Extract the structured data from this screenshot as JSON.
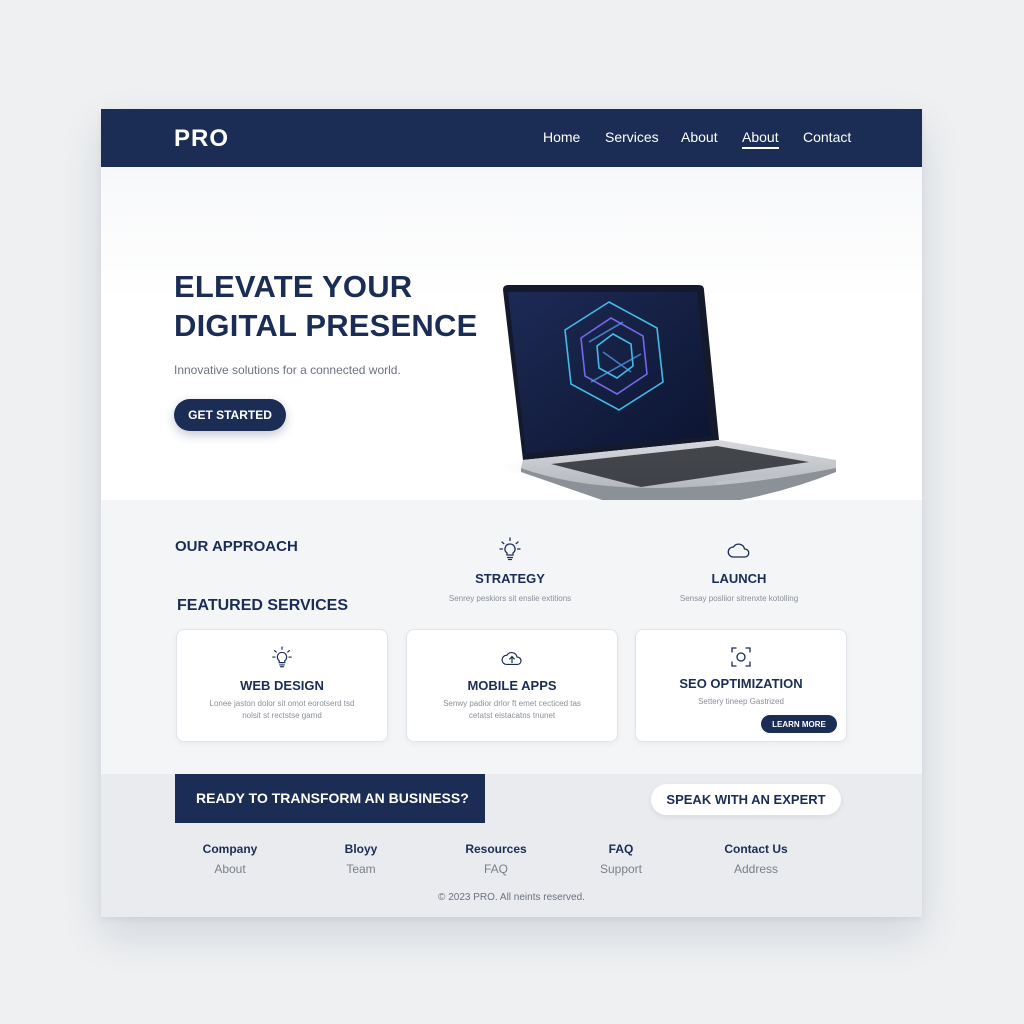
{
  "nav": {
    "logo": "PRO",
    "links": [
      "Home",
      "Services",
      "About",
      "About",
      "Contact"
    ]
  },
  "hero": {
    "title_line1": "ELEVATE YOUR",
    "title_line2": "DIGITAL PRESENCE",
    "subtitle": "Innovative solutions for a connected world.",
    "cta": "GET STARTED"
  },
  "approach": {
    "title": "OUR APPROACH",
    "steps": [
      {
        "icon": "lightbulb-icon",
        "title": "STRATEGY",
        "desc": "Senrey peskiors sit enslie extitions"
      },
      {
        "icon": "cloud-icon",
        "title": "LAUNCH",
        "desc": "Sensay posliior sitrenxte kotolling"
      }
    ]
  },
  "services": {
    "title": "FEATURED SERVICES",
    "cards": [
      {
        "icon": "lightbulb-icon",
        "title": "WEB DESIGN",
        "desc": "Lonee jaston dolor sit omot eorotserd tsd nolsit st rectstse gamd"
      },
      {
        "icon": "cloud-upload-icon",
        "title": "MOBILE APPS",
        "desc": "Senwy padior drlor ft emet cecticed tas cetatst eistacatns tnunet"
      },
      {
        "icon": "focus-icon",
        "title": "SEO OPTIMIZATION",
        "desc": "Settery tineep Gastrized",
        "button": "LEARN MORE"
      }
    ]
  },
  "footer": {
    "cta_text": "READY TO TRANSFORM AN BUSINESS?",
    "expert_button": "SPEAK WITH AN EXPERT",
    "columns": [
      {
        "head": "Company",
        "link": "About"
      },
      {
        "head": "Bloyy",
        "link": "Team"
      },
      {
        "head": "Resources",
        "link": "FAQ"
      },
      {
        "head": "FAQ",
        "link": "Support"
      },
      {
        "head": "Contact Us",
        "link": "Address"
      }
    ],
    "copyright": "© 2023 PRO. All neints reserved."
  },
  "colors": {
    "brand": "#1b2d55",
    "accent_glow": "#3fb4e6",
    "background": "#eef0f2"
  }
}
